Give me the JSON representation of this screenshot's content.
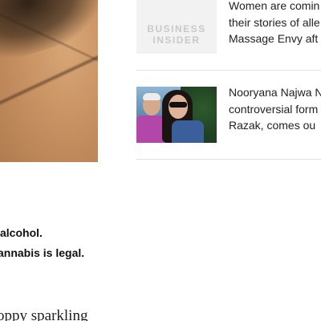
{
  "article": {
    "paragraph_line_1": "alcohol.",
    "paragraph_line_2": "annabis is legal.",
    "next_paragraph_start": "oppy sparkling"
  },
  "sidebar": {
    "items": [
      {
        "thumb_logo_line_1": "BUSINESS",
        "thumb_logo_line_2": "INSIDER",
        "lines": [
          "Women are comin",
          "their stories of alle",
          "Massage Envy aft"
        ]
      },
      {
        "lines": [
          "Nooryana Najwa N",
          "controversial form",
          "Razak, comes ou"
        ]
      }
    ]
  },
  "colors": {
    "divider": "#e2e2e2",
    "logo_gray": "#c9c9c9",
    "text": "#222222"
  }
}
